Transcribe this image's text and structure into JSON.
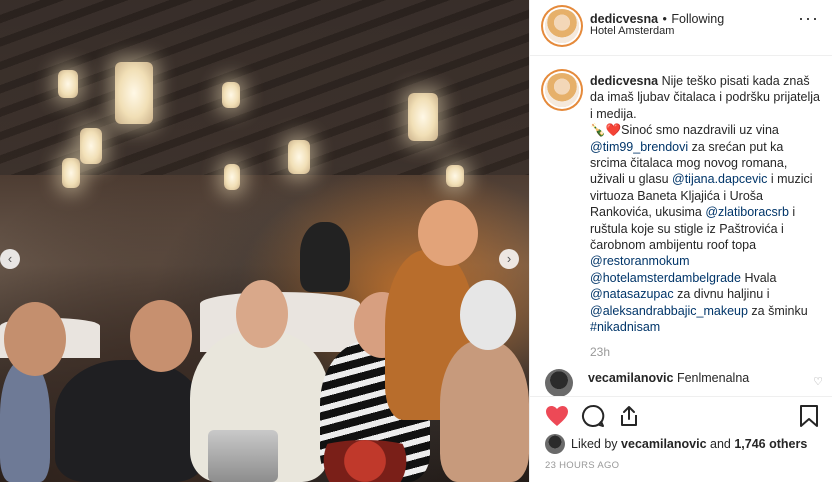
{
  "post": {
    "username": "dedicvesna",
    "follow_status": "Following",
    "separator": "•",
    "location": "Hotel Amsterdam"
  },
  "caption": {
    "username": "dedicvesna",
    "text_1": "Nije teško pisati kada znaš da imaš ljubav čitalaca i podršku prijatelja i medija.",
    "emoji": "🍾❤️",
    "text_2": "Sinoć smo nazdravili uz vina",
    "mention_1": "@tim99_brendovi",
    "text_3": "za srećan put ka srcima čitalaca mog novog romana, uživali u glasu",
    "mention_2": "@tijana.dapcevic",
    "text_4": "i muzici virtuoza Baneta Kljajića i Uroša Rankovića, ukusima",
    "mention_3": "@zlatiboracsrb",
    "text_5": "i ruštula koje su stigle iz Paštrovića i čarobnom ambijentu roof topa",
    "mention_4": "@restoranmokum",
    "mention_5": "@hotelamsterdambelgrade",
    "text_6": "Hvala",
    "mention_6": "@natasazupac",
    "text_7": "za divnu haljinu i",
    "mention_7": "@aleksandrabbajic_makeup",
    "text_8": "za šminku",
    "hashtag": "#nikadnisam"
  },
  "caption_time": "23h",
  "comment": {
    "username": "vecamilanovic",
    "text": "Fenlmenalna"
  },
  "likes": {
    "prefix": "Liked by",
    "user": "vecamilanovic",
    "middle": "and",
    "count": "1,746 others"
  },
  "post_time": "23 HOURS AGO",
  "icons": {
    "like": "heart-filled-icon",
    "comment": "comment-icon",
    "share": "share-icon",
    "save": "bookmark-icon",
    "more": "more-icon",
    "prev": "chevron-left-icon",
    "next": "chevron-right-icon"
  },
  "colors": {
    "like_red": "#ed4956",
    "link": "#003569",
    "muted": "#999999",
    "story_ring": "#e58a3b"
  }
}
